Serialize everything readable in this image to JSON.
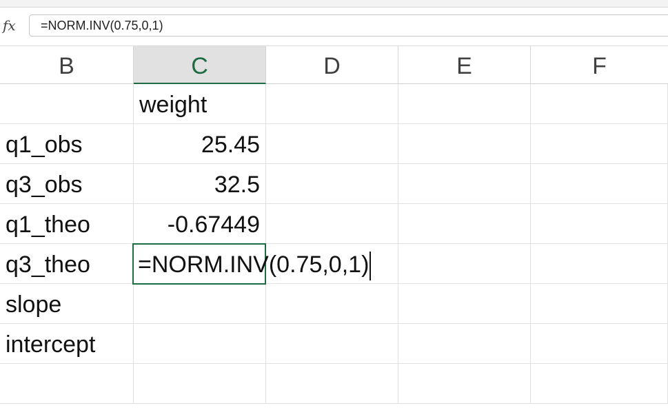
{
  "formula_bar": {
    "fx_icon": "fx",
    "formula": "=NORM.INV(0.75,0,1)"
  },
  "columns": [
    "B",
    "C",
    "D",
    "E",
    "F"
  ],
  "active_column": "C",
  "rows": [
    {
      "B": "",
      "C": "weight"
    },
    {
      "B": "q1_obs",
      "C": "25.45"
    },
    {
      "B": "q3_obs",
      "C": "32.5"
    },
    {
      "B": "q1_theo",
      "C": "-0.67449"
    },
    {
      "B": "q3_theo",
      "C": "=NORM.INV(0.75,0,1)"
    },
    {
      "B": "slope",
      "C": ""
    },
    {
      "B": "intercept",
      "C": ""
    },
    {
      "B": "",
      "C": ""
    }
  ],
  "colors": {
    "accent": "#1e6b41",
    "header_active_bg": "#e1e1e1"
  }
}
